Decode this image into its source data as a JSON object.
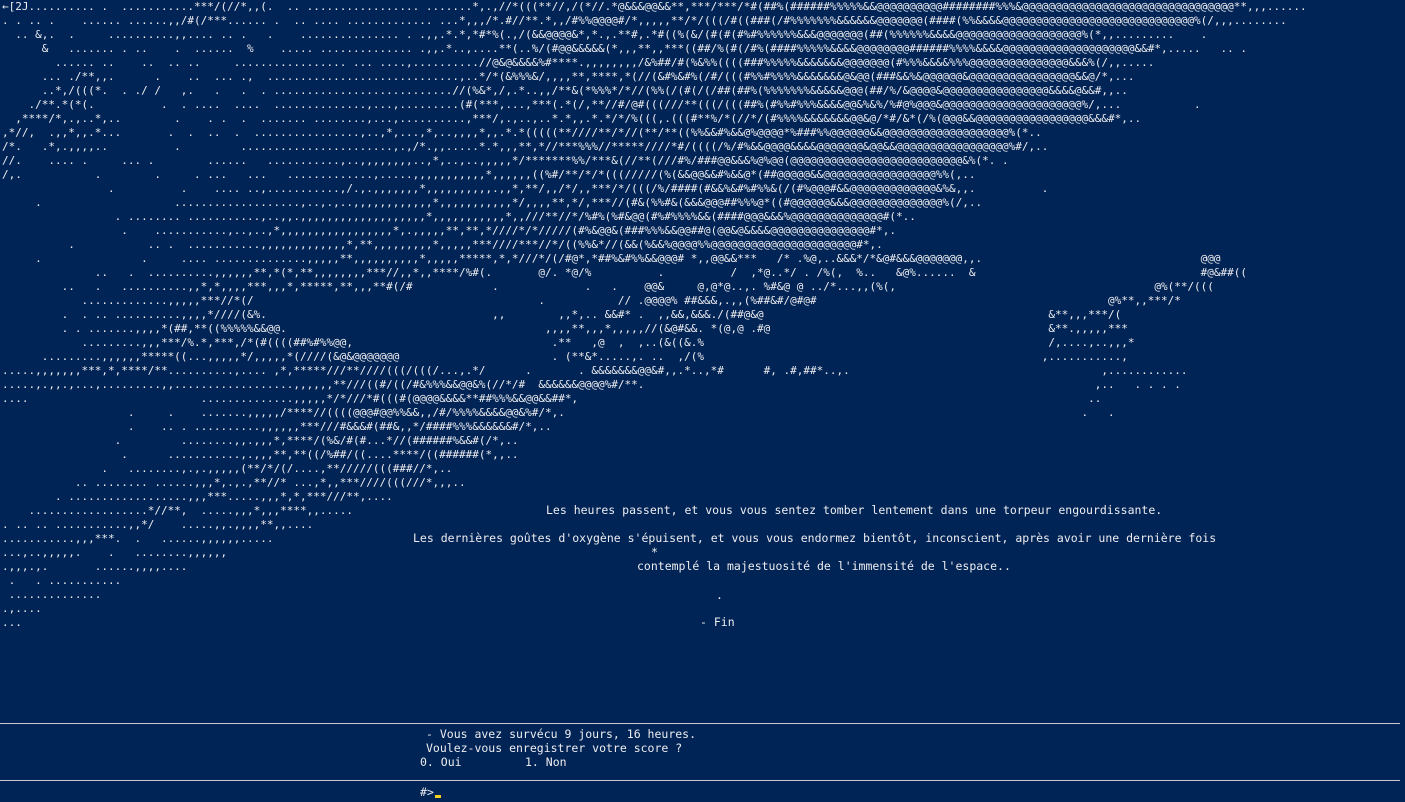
{
  "ascii_art": "←[2J.......... .  ...........***/(//*,,(.  .. ................. .......*,.,//*(((**//,/(*//.*@&&&@@&&**,***/***/*#(##%(######%%%%%&&@@@@@@@@@@########%%%&@@@@@@@@@@@@@@@@@@@@@@@@@@@@@@@@**,,,......\n. . .. .    ...... ......,,/#(/***...... .  .. .... ............. ...*,,,/*.#//**.*,,/#%%@@@@#/*,,,,,**/*/(((/#((###(/#%%%%%%%&&&&&&@@@@@@@(####(%%&&&&@@@@@@@@@@@@@@@@@@@@@@@@@@@@@%(/,,,........\n  .. &,.  .     ..........,,.... .. .   .    ............... . .,,.*.*,*#*%(.,/(&&@@@@&*,*.,.**#,.*#((%(&/(#(#(#%#%%%%%%&&&@@@@@@@(##(%%%%%%&&&&@@@@@@@@@@@@@@@@@@@%(*,,.........    .\n      &   ....... . ..    .  ......  %    ..... .............. .,,.*..,....**(..%/(#@@&&&&&(*,,,**,,***((##/%(#(/#%(####%%%%%&&&&@@@@@@@@######%%%%&&&&@@@@@@@@@@@@@@@@@@@@&&#*,.....   .. .\n        ...... ..    ..  .. ..     ................. ... ....,..........//@&@&&&&%#****.,,,,,,,,/&%##/#(%&%%((((###%%%%%&&&&&&&@@@@@@@(#%%%&&&&%%%@@@@@@@@@@@@@@@&&&%(/,,.....\n      ... ./**,,.      .    ..  ... .,  .............................,..*/*(&%%%&/,,,,**,****,*(//(&#%&#%(/#/(((#%%#%%%%&&&&&&&@&@@(###&&%&@@@@@@&@@@@@@@@@@@@@@@@&&@/*,...\n      ..*,/(((*.  . ./ /   ,.   .   .  . ...........................//(%&*,/,.*..,,/**&(*%%%*/*//(%%(/(#(/(/##(##%(%%%%%%%&&&&&@@@(##/%/&@@@@&@@@@@@@@@@@@@@@@&&&&@&&#,,..\n    ./**.*(*(.          .  . ....  ....  ..............,...,.........(#(***,...,***(.*(/,**//#/@#(((///**(((/(((##%(#%%#%%%&&&&@@&%&%/%#@%@@@&@@@@@@@@@@@@@@@@@@@@@%/,...           .\n  ,****/*,.,..*,..        .    . .  .  ....... ........,...,..........,***/,.,..,..*.*,,.*.*/*/%(((,.(((#**%/*(//*/(#%%%%&&&&&&&@@&@/*#/&*(/%(@@@&&@@@@@@@@@@@@@@@@@&&&#*,..\n,*//,  .,,*,,.*...       .  .  ..  .  ................,..,*,...,*,..,,,,*,,.*.*(((((**////**/*//(**/**((%%&&#%&&@%@@@@*%###%%@@@@@@&&@@@@@@@@@@@@@@@@@@@%(*..\n/*.   .*,.,,,,..          .         .......................,.,/*.,,.....*.*,,,**,*//***%%%//*****////*#/((((/%/#%&&@@@@&&&&@@@@@@@&@@&&@@@@@@@@@@@@@@@@@%#/,..\n//.    .... .     ... .        ......   ...........,..,,,,,,,,..,*,..,..,,,,,*/*******%%/***&(//**(///#%/###@@&&&%@%@@(@@@@@@@@@@@@@@@@@@@@@@@@@@&%(*. .\n/,.           .        .     . ...   ...   .............,.....,,,,,,,,,,,*,,,,,,((%#/**/*/*(((/////(%(&&@@&&#%&&@*(##@@@@@&&@@@@@@@@@@@@@@@@@%%(,..\n                .          .    .... ..,...........,/.,.,,,,,,,*,,,,,,,,,,.,,*,**/,,/*/,,***/*/(((/%/####(#&&%&#%#%%&(/(#%@@@#&&@@@@@@@@@@@@@&%&,,.          .\n     .                    ...................,..,.,..,,,,,,,,,,,,*,,,,,,,,,,,*/,,,,**,*/,***//(#&(%%#&(&&&@@@##%%%@*((#@@@@@@&&&@@@@@@@@@@@@@@%(/,..\n                 . ........ ...........,..,,.,,,,,,,,,,,,,,,,,,,*,,,,,,,,,,,*,,///**//*/%#%(%#&@@(#%#%%%%&&(####@@@&&&%@@@@@@@@@@@@@@#(*..\n                  .    ...........,..,..,*,,,,,,,,,,,,,,,,,*,.,,,,,**,**,*////*/*/////(#%&@@&(###%%%&&@@##@(@@&@&&&&@@@@@@@@@@@@@@@#*,.\n          .           .. .  ...........,,,,,,,,,,,,,*,**,,,,,,,,,*,,,,,***////***//*/((%%&*//(&&(%&&%@@@@%%@@@@@@@@@@@@@@@@@@@@@@#*,.\n     .               .     .... ..............,,,,,**,,,,,,,,,,*,,,,,*****,*,*///*/(/#@*,*##%&#%%&&@@@# *,,@@&&***   /* .%@,..&&&*/*&@#&&&@@@@@@@,,.                                 @@@\n              ..   .  ..........,,,,,,**,*(*,**,,,,,,,,***//,,*,,****/%#(.       @/. *@/%          .          /  ,*@..*/ . /%(,  %..   &@%......  &                                  #@&##((\n         ..   .   ..........,,*,*,,,,***,,,*,*****,**,,,**#(/#            .             .   .    @@&     @,@*@..,. %#&@ @ ../*...,,(%(,                                       @%(**/(((\n            .............,,,,,***//*(/                                           .           // .@@@@% ##&&&,.,,(%##&#/@#@#                                            @%**,,***/*\n         .  . .. ..........,,,,*////(&%.                                  ,,        ,,*,.. &&#* .  ,,&&,&&&./(##@&@                                           &**,,,***/(\n         . . .......,,,,*(##,**((%%%%%&&@@.                                       ,,,,**,,,*,,,,,//(&@#&&. *(@,@ .#@                                          &**.,,,,,***\n            .........,,,***/%.*,***,/*(#((((##%#%%@@,                              .**   ,@  ,  ,..(&((&.%                                                    /,....,..,,,*\n      .........,,,,,,*****((...,,,,,*/,,,,,*(////(&@&@@@@@@@                       . (**&*.....,. ..  ,/(%                                                   ,...........,\n.....,,,,,,,***,*,****/**..........,.... ,*,*****///**////(((/(((/...,.*/      .       . &&&&&&&@@&#,,.*..,*#      #, .#,##*..,.                                      ,............\n.....,.,,.,...,.........,,..................,,,,,,**///((#/((/#&%%%&&@@&%(//*/#  &&&&&&@@@@%#/**.                                                                    ,..   . . . .\n....                          ..............,,,,,*/*///*#(((#(@@@@&&&&**##%%%&&@@&&##*,                                                                             ..\n                   .     .    .......,,,,,/****//((((@@@#@@%%&&,,/#/%%%%&&&&@@&%#/*,.                                                                              .   .\n                   .    .. . ..........,,,,,,***///#&&&#(##&,,*/####%%%&&&&&&#/*,..\n                 .         ........,,.,,,*,****/(%&/#(#...*//(######%&&#(/*,..\n                  .      ...........,.,,,**,**((/%##/((....****/((######(*,,..\n               .   ........,.,.,,,,,(**/*/(/....,**/////(((###//*,..\n           .. ........ ......,,,*,.,.,**//* ...,*,,***////(((///*,,,..\n        . ..................,,,***.....,,,*,*,***///**,....\n    ..................*//**,  .....,,,*,,,****,,.....\n. .. .. ...........,,*/    .....,,.,,,,**,,....\n...........,,,***.  .   ......,,,,,,.....\n...,..,,,,,.    .   ........,,,,,,\n.,,,.,.       ......,,,,....\n .   . ...........\n ..............\n.,....\n...",
  "story": {
    "line1": "Les heures passent, et vous vous sentez tomber lentement dans une torpeur engourdissante.",
    "line2": "Les dernières goûtes d'oxygène s'épuisent, et vous vous endormez bientôt, inconscient, après avoir une dernière fois",
    "star": "*",
    "line3": "contemplé la majestuosité de l'immensité de l'espace..",
    "dot": ".",
    "fin": "- Fin"
  },
  "prompt": {
    "survived": "- Vous avez survécu 9 jours, 16 heures.",
    "question": "Voulez-vous enregistrer votre score ?",
    "option_yes": "0. Oui",
    "option_no": "1. Non",
    "command_prompt": "#>"
  },
  "colors": {
    "background": "#012456",
    "text": "#eeedf0",
    "cursor": "#f5d020"
  }
}
